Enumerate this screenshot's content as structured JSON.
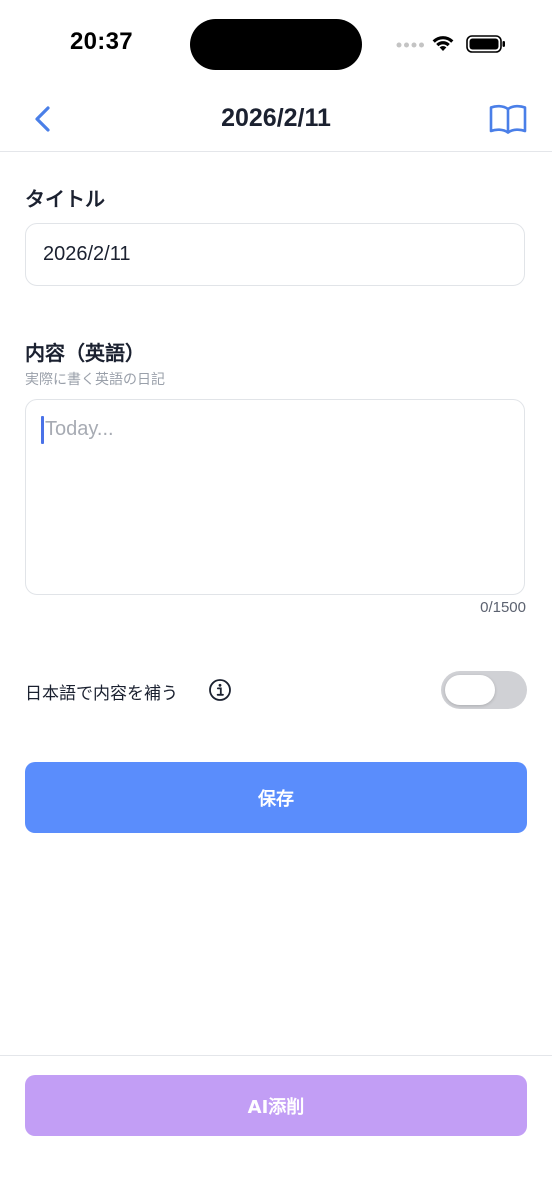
{
  "status_bar": {
    "time": "20:37",
    "icons": [
      "cellular-signal-icon",
      "wifi-icon",
      "battery-icon"
    ]
  },
  "nav": {
    "title": "2026/2/11",
    "back_icon": "chevron-left-icon",
    "right_icon": "open-book-icon"
  },
  "form": {
    "title_label": "タイトル",
    "title_value": "2026/2/11",
    "content_label": "内容（英語）",
    "content_sublabel": "実際に書く英語の日記",
    "content_placeholder": "Today...",
    "char_count": "0/1500"
  },
  "toggle": {
    "label": "日本語で内容を補う",
    "info_icon": "info-circle-icon",
    "enabled": false
  },
  "buttons": {
    "save_label": "保存",
    "ai_label": "AI添削"
  },
  "colors": {
    "accent": "#5a8dfc",
    "ai_button": "#c29ef5",
    "back_icon": "#4a7fe8",
    "toggle_off": "#d0d1d5"
  }
}
